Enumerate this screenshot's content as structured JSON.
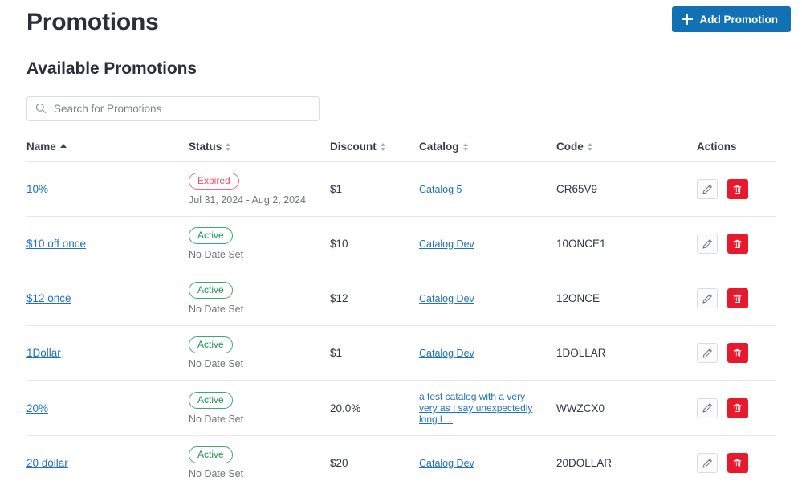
{
  "header": {
    "title": "Promotions",
    "add_button_label": "Add Promotion",
    "add_button_icon": "plus-icon",
    "accent_color": "#1271b5"
  },
  "section": {
    "title": "Available Promotions"
  },
  "search": {
    "placeholder": "Search for Promotions",
    "value": "",
    "icon": "search-icon"
  },
  "table": {
    "columns": [
      {
        "label": "Name",
        "sort": "asc"
      },
      {
        "label": "Status",
        "sort": "none"
      },
      {
        "label": "Discount",
        "sort": "none"
      },
      {
        "label": "Catalog",
        "sort": "none"
      },
      {
        "label": "Code",
        "sort": "none"
      },
      {
        "label": "Actions",
        "sort": null
      }
    ],
    "status_colors": {
      "active": "#1f9255",
      "expired": "#ef4f63"
    },
    "action_icons": {
      "edit": "pencil-icon",
      "delete": "trash-icon"
    },
    "rows": [
      {
        "name": "10%",
        "status": "Expired",
        "status_kind": "expired",
        "dates": "Jul 31, 2024 - Aug 2, 2024",
        "discount": "$1",
        "catalog": "Catalog 5",
        "code": "CR65V9"
      },
      {
        "name": "$10 off once",
        "status": "Active",
        "status_kind": "active",
        "dates": "No Date Set",
        "discount": "$10",
        "catalog": "Catalog Dev",
        "code": "10ONCE1"
      },
      {
        "name": "$12 once",
        "status": "Active",
        "status_kind": "active",
        "dates": "No Date Set",
        "discount": "$12",
        "catalog": "Catalog Dev",
        "code": "12ONCE"
      },
      {
        "name": "1Dollar",
        "status": "Active",
        "status_kind": "active",
        "dates": "No Date Set",
        "discount": "$1",
        "catalog": "Catalog Dev",
        "code": "1DOLLAR"
      },
      {
        "name": "20%",
        "status": "Active",
        "status_kind": "active",
        "dates": "No Date Set",
        "discount": "20.0%",
        "catalog": "a test catalog with a very very as I say unexpectedly long l ...",
        "code": "WWZCX0"
      },
      {
        "name": "20 dollar",
        "status": "Active",
        "status_kind": "active",
        "dates": "No Date Set",
        "discount": "$20",
        "catalog": "Catalog Dev",
        "code": "20DOLLAR"
      }
    ]
  }
}
